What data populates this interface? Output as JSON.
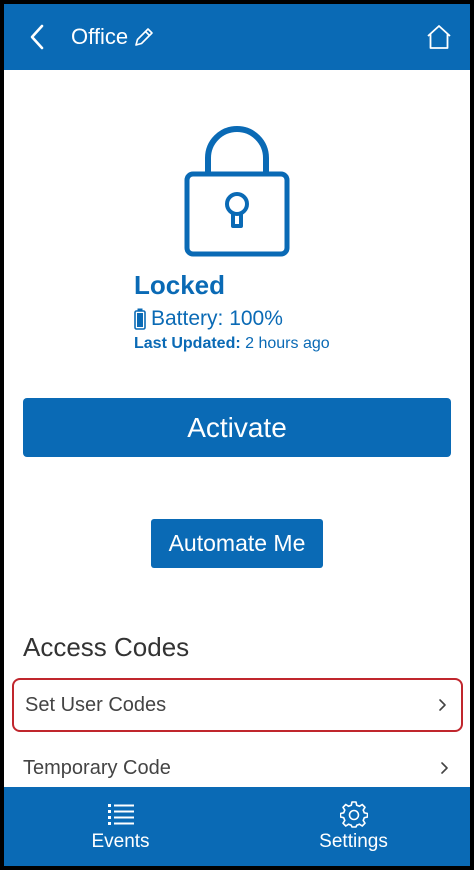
{
  "header": {
    "title": "Office",
    "back_icon": "chevron-left-icon",
    "edit_icon": "pencil-icon",
    "home_icon": "home-icon"
  },
  "lock": {
    "icon": "lock-icon",
    "status": "Locked",
    "battery_icon": "battery-icon",
    "battery_text": "Battery: 100%",
    "battery_level": 1.0,
    "last_updated_label": "Last Updated:",
    "last_updated_value": "2 hours ago"
  },
  "actions": {
    "activate_label": "Activate",
    "automate_label": "Automate Me"
  },
  "access_codes": {
    "title": "Access Codes",
    "items": [
      {
        "label": "Set User Codes"
      },
      {
        "label": "Temporary Code"
      }
    ]
  },
  "bottom_nav": {
    "items": [
      {
        "label": "Events",
        "icon": "list-icon"
      },
      {
        "label": "Settings",
        "icon": "gear-icon"
      }
    ]
  },
  "colors": {
    "brand_blue": "#0a6ab5",
    "highlight_red": "#c0262d"
  }
}
